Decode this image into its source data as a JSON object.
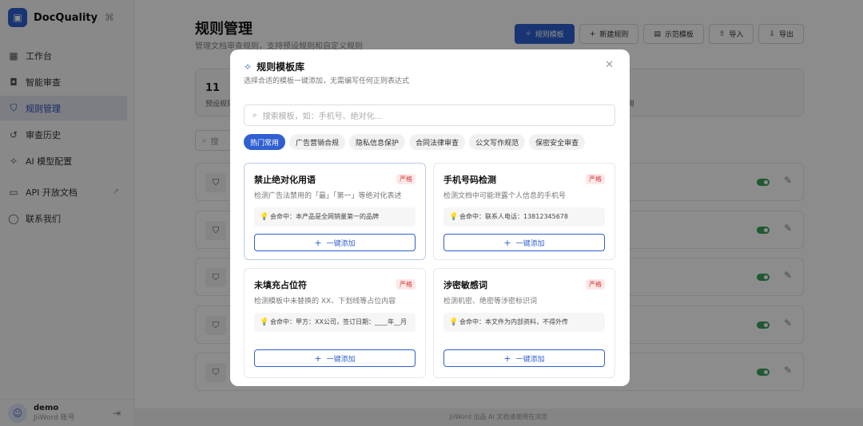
{
  "sidebar": {
    "brand": "DocQuality",
    "items": [
      {
        "label": "工作台",
        "icon": "grid-icon"
      },
      {
        "label": "智能审查",
        "icon": "robot-icon"
      },
      {
        "label": "规则管理",
        "icon": "shield-icon"
      },
      {
        "label": "审查历史",
        "icon": "history-icon"
      },
      {
        "label": "AI 模型配置",
        "icon": "sparkle-icon"
      },
      {
        "label": "API 开放文档",
        "icon": "book-icon"
      },
      {
        "label": "联系我们",
        "icon": "chat-icon"
      }
    ],
    "user": {
      "name": "demo",
      "sub": "JiiWord 账号"
    }
  },
  "header": {
    "title": "规则管理",
    "subtitle": "管理文档审查规则，支持预设规则和自定义规则",
    "buttons": [
      "规则模板",
      "新建规则",
      "示范模板",
      "导入",
      "导出"
    ]
  },
  "stats": {
    "num": "11",
    "label": "预设规则",
    "label2": "用"
  },
  "search": {
    "placeholder": "搜"
  },
  "footer": "JiiWord 出品 AI 文档请使用在浏览",
  "modal": {
    "title": "规则模板库",
    "subtitle": "选择合适的模板一键添加，无需编写任何正则表达式",
    "search_placeholder": "搜索模板，如：手机号、绝对化...",
    "categories": [
      "热门常用",
      "广告营销合规",
      "隐私信息保护",
      "合同法律审查",
      "公文写作规范",
      "保密安全审查"
    ],
    "cards": [
      {
        "name": "禁止绝对化用语",
        "badge": "严格",
        "desc": "检测广告法禁用的「最」「第一」等绝对化表述",
        "example": "会命中：本产品是全网销量第一的品牌",
        "button": "一键添加"
      },
      {
        "name": "手机号码检测",
        "badge": "严格",
        "desc": "检测文档中可能泄露个人信息的手机号",
        "example": "会命中：联系人电话：13812345678",
        "button": "一键添加"
      },
      {
        "name": "未填充占位符",
        "badge": "严格",
        "desc": "检测模板中未替换的 XX、下划线等占位内容",
        "example": "会命中：甲方：XX公司，签订日期：____年__月",
        "button": "一键添加"
      },
      {
        "name": "涉密敏感词",
        "badge": "严格",
        "desc": "检测机密、绝密等涉密标识词",
        "example": "会命中：本文件为内部资料，不得外传",
        "button": "一键添加"
      }
    ]
  },
  "colors": {
    "accent": "#2f5fd0",
    "badge_red": "#d43b3b",
    "toggle_green": "#3aa35a"
  }
}
